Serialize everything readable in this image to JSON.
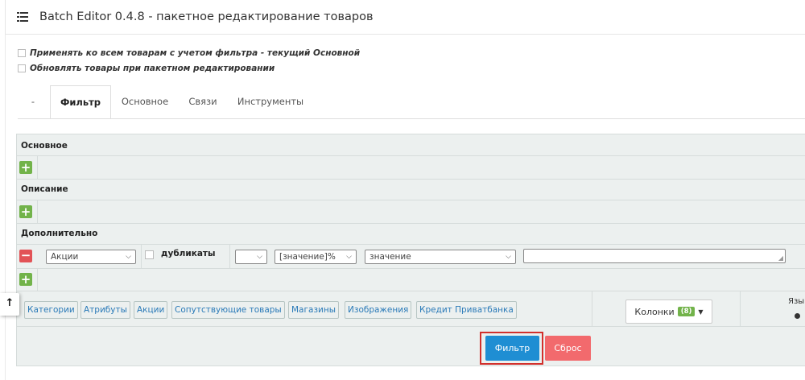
{
  "header": {
    "title": "Batch Editor 0.4.8 - пакетное редактирование товаров"
  },
  "options": {
    "apply_all": "Применять ко всем товарам с учетом фильтра - текущий Основной",
    "update_products": "Обновлять товары при пакетном редактировании"
  },
  "tabs": [
    {
      "label": "-"
    },
    {
      "label": "Фильтр"
    },
    {
      "label": "Основное"
    },
    {
      "label": "Связи"
    },
    {
      "label": "Инструменты"
    }
  ],
  "sections": {
    "main": "Основное",
    "description": "Описание",
    "additional": "Дополнительно"
  },
  "condition": {
    "field": "Акции",
    "duplicates_label": "дубликаты",
    "operator": "",
    "mode": "[значение]%",
    "value_type": "значение",
    "value": ""
  },
  "links": [
    {
      "label": "Категории"
    },
    {
      "label": "Атрибуты"
    },
    {
      "label": "Акции"
    },
    {
      "label": "Сопутствующие товары"
    },
    {
      "label": "Магазины"
    },
    {
      "label": "Изображения"
    },
    {
      "label": "Кредит Приватбанка"
    }
  ],
  "columns_button": {
    "label": "Колонки",
    "count": "(8)"
  },
  "language_label": "Язы",
  "actions": {
    "filter": "Фильтр",
    "reset": "Сброс"
  },
  "colors": {
    "accent": "#1f8ed3",
    "danger": "#f26a6d",
    "success": "#72b34a",
    "highlight": "#d2302c"
  },
  "icons": [
    "list-icon",
    "plus-icon",
    "minus-icon",
    "chevron-down-icon",
    "caret-down-icon",
    "arrow-up-icon"
  ]
}
